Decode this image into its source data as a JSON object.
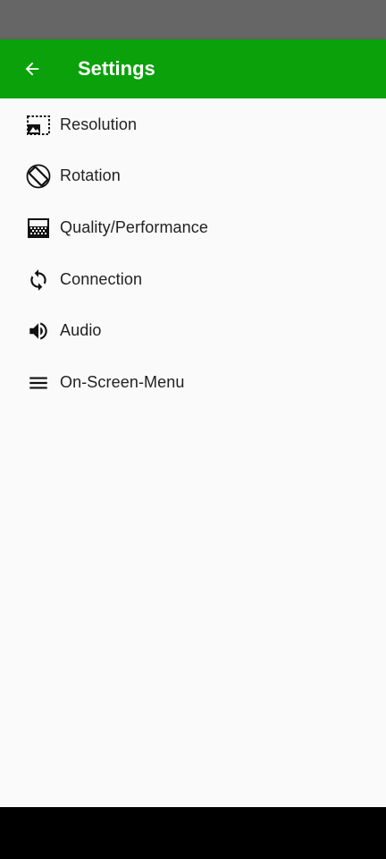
{
  "app_bar": {
    "title": "Settings",
    "back_icon": "arrow-back-icon",
    "color": "#0aa10a"
  },
  "menu": {
    "items": [
      {
        "label": "Resolution",
        "icon": "resolution-icon"
      },
      {
        "label": "Rotation",
        "icon": "screen-rotation-icon"
      },
      {
        "label": "Quality/Performance",
        "icon": "quality-icon"
      },
      {
        "label": "Connection",
        "icon": "connection-sync-icon"
      },
      {
        "label": "Audio",
        "icon": "volume-icon"
      },
      {
        "label": "On-Screen-Menu",
        "icon": "menu-icon"
      }
    ]
  },
  "colors": {
    "status_bar": "#666666",
    "background": "#fafafa",
    "nav_bar": "#000000",
    "text": "#222222"
  }
}
